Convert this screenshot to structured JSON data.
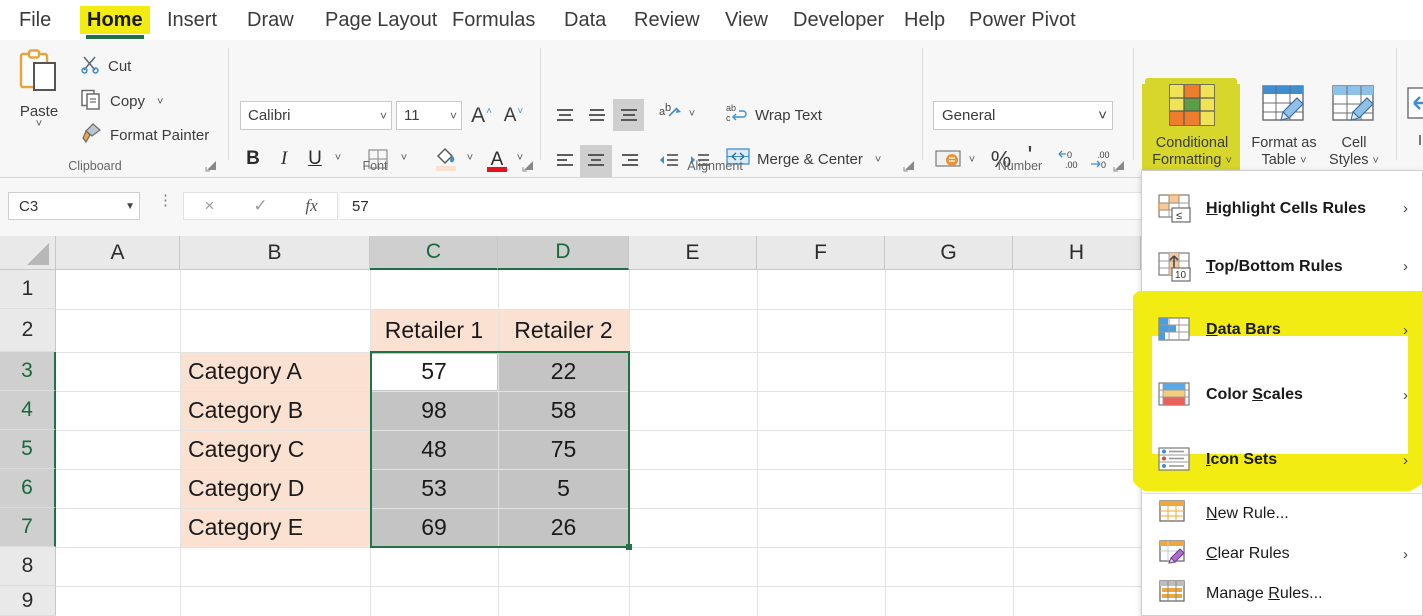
{
  "app": {
    "accent_green": "#217346",
    "highlight_yellow": "#f2ec12",
    "highlight_olive": "#d6d62b",
    "selection_gray": "#c4c4c4",
    "header_peach": "#fbe1d2"
  },
  "tabs": [
    {
      "label": "File",
      "active": false
    },
    {
      "label": "Home",
      "active": true
    },
    {
      "label": "Insert",
      "active": false
    },
    {
      "label": "Draw",
      "active": false
    },
    {
      "label": "Page Layout",
      "active": false
    },
    {
      "label": "Formulas",
      "active": false
    },
    {
      "label": "Data",
      "active": false
    },
    {
      "label": "Review",
      "active": false
    },
    {
      "label": "View",
      "active": false
    },
    {
      "label": "Developer",
      "active": false
    },
    {
      "label": "Help",
      "active": false
    },
    {
      "label": "Power Pivot",
      "active": false
    }
  ],
  "ribbon": {
    "clipboard": {
      "group_label": "Clipboard",
      "paste_label": "Paste",
      "cut_label": "Cut",
      "copy_label": "Copy",
      "format_painter_label": "Format Painter"
    },
    "font": {
      "group_label": "Font",
      "font_name": "Calibri",
      "font_size": "11",
      "grow_label": "A",
      "shrink_label": "A",
      "bold_label": "B",
      "italic_label": "I",
      "underline_label": "U"
    },
    "alignment": {
      "group_label": "Alignment",
      "wrap_text_label": "Wrap Text",
      "merge_center_label": "Merge & Center"
    },
    "number": {
      "group_label": "Number",
      "format_value": "General",
      "percent_label": "%",
      "comma_label": "'"
    },
    "styles": {
      "conditional_formatting_line1": "Conditional",
      "conditional_formatting_line2": "Formatting",
      "format_as_table_line1": "Format as",
      "format_as_table_line2": "Table",
      "cell_styles_line1": "Cell",
      "cell_styles_line2": "Styles",
      "insert_partial_label": "In"
    }
  },
  "formula_bar": {
    "name_box_value": "C3",
    "cancel_icon": "×",
    "enter_icon": "✓",
    "function_icon": "fx",
    "formula_value": "57"
  },
  "grid": {
    "columns": [
      "A",
      "B",
      "C",
      "D",
      "E",
      "F",
      "G",
      "H"
    ],
    "selected_columns": [
      "C",
      "D"
    ],
    "rows": [
      "1",
      "2",
      "3",
      "4",
      "5",
      "6",
      "7",
      "8",
      "9"
    ],
    "selected_rows": [
      "3",
      "4",
      "5",
      "6",
      "7"
    ],
    "active_cell": "C3",
    "cells": [
      {
        "ref": "C2",
        "value": "Retailer 1",
        "col": "C",
        "row": "2",
        "align": "c"
      },
      {
        "ref": "D2",
        "value": "Retailer 2",
        "col": "D",
        "row": "2",
        "align": "c"
      },
      {
        "ref": "B3",
        "value": "Category A",
        "col": "B",
        "row": "3",
        "align": "l"
      },
      {
        "ref": "B4",
        "value": "Category B",
        "col": "B",
        "row": "4",
        "align": "l"
      },
      {
        "ref": "B5",
        "value": "Category C",
        "col": "B",
        "row": "5",
        "align": "l"
      },
      {
        "ref": "B6",
        "value": "Category D",
        "col": "B",
        "row": "6",
        "align": "l"
      },
      {
        "ref": "B7",
        "value": "Category E",
        "col": "B",
        "row": "7",
        "align": "l"
      },
      {
        "ref": "C3",
        "value": "57",
        "col": "C",
        "row": "3",
        "align": "c"
      },
      {
        "ref": "C4",
        "value": "98",
        "col": "C",
        "row": "4",
        "align": "c"
      },
      {
        "ref": "C5",
        "value": "48",
        "col": "C",
        "row": "5",
        "align": "c"
      },
      {
        "ref": "C6",
        "value": "53",
        "col": "C",
        "row": "6",
        "align": "c"
      },
      {
        "ref": "C7",
        "value": "69",
        "col": "C",
        "row": "7",
        "align": "c"
      },
      {
        "ref": "D3",
        "value": "22",
        "col": "D",
        "row": "3",
        "align": "c"
      },
      {
        "ref": "D4",
        "value": "58",
        "col": "D",
        "row": "4",
        "align": "c"
      },
      {
        "ref": "D5",
        "value": "75",
        "col": "D",
        "row": "5",
        "align": "c"
      },
      {
        "ref": "D6",
        "value": "5",
        "col": "D",
        "row": "6",
        "align": "c"
      },
      {
        "ref": "D7",
        "value": "26",
        "col": "D",
        "row": "7",
        "align": "c"
      }
    ]
  },
  "table_data": {
    "type": "table",
    "column_headers": [
      "",
      "Retailer 1",
      "Retailer 2"
    ],
    "rows": [
      {
        "category": "Category A",
        "retailer_1": 57,
        "retailer_2": 22
      },
      {
        "category": "Category B",
        "retailer_1": 98,
        "retailer_2": 58
      },
      {
        "category": "Category C",
        "retailer_1": 48,
        "retailer_2": 75
      },
      {
        "category": "Category D",
        "retailer_1": 53,
        "retailer_2": 5
      },
      {
        "category": "Category E",
        "retailer_1": 69,
        "retailer_2": 26
      }
    ]
  },
  "menu": {
    "items": [
      {
        "label": "Highlight Cells Rules",
        "mnemonic": "H",
        "submenu": true,
        "highlighted": false
      },
      {
        "label": "Top/Bottom Rules",
        "mnemonic": "T",
        "submenu": true,
        "highlighted": false
      },
      {
        "label": "Data Bars",
        "mnemonic": "D",
        "submenu": true,
        "highlighted": true
      },
      {
        "label": "Color Scales",
        "mnemonic": "S",
        "submenu": true,
        "highlighted": true
      },
      {
        "label": "Icon Sets",
        "mnemonic": "I",
        "submenu": true,
        "highlighted": true
      },
      {
        "label": "New Rule...",
        "mnemonic": "N",
        "submenu": false,
        "highlighted": false
      },
      {
        "label": "Clear Rules",
        "mnemonic": "C",
        "submenu": true,
        "highlighted": false
      },
      {
        "label": "Manage Rules...",
        "mnemonic": "R",
        "submenu": false,
        "highlighted": false
      }
    ],
    "arrow_glyph": "›"
  }
}
